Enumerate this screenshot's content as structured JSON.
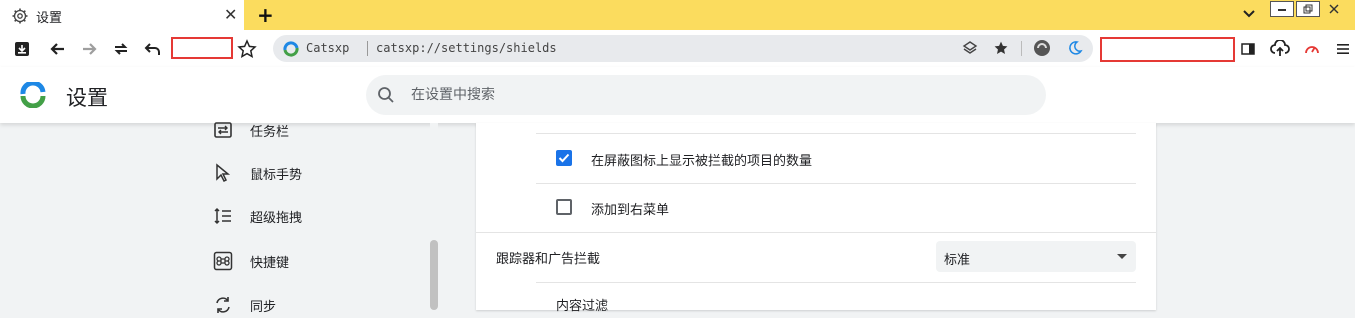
{
  "tab": {
    "title": "设置",
    "close": "✕"
  },
  "newtab": "+",
  "address": {
    "site_name": "Catsxp",
    "url": "catsxp://settings/shields"
  },
  "header": {
    "title": "设置",
    "search_placeholder": "在设置中搜索"
  },
  "sidebar": {
    "items": [
      {
        "label": "任务栏",
        "icon": "taskbar-icon"
      },
      {
        "label": "鼠标手势",
        "icon": "cursor-icon"
      },
      {
        "label": "超级拖拽",
        "icon": "vertical-drag-icon"
      },
      {
        "label": "快捷键",
        "icon": "command-key-icon"
      },
      {
        "label": "同步",
        "icon": "sync-icon"
      }
    ]
  },
  "settings": {
    "show_blocked_count": {
      "label": "在屏蔽图标上显示被拦截的项目的数量",
      "checked": true
    },
    "add_to_context_menu": {
      "label": "添加到右菜单",
      "checked": false
    },
    "tracker_ad_blocking": {
      "label": "跟踪器和广告拦截",
      "value": "标准"
    },
    "content_filter": {
      "label": "内容过滤"
    }
  },
  "colors": {
    "titlebar": "#fbdc5e",
    "accent": "#1a73e8",
    "highlight_box": "#e53935"
  }
}
